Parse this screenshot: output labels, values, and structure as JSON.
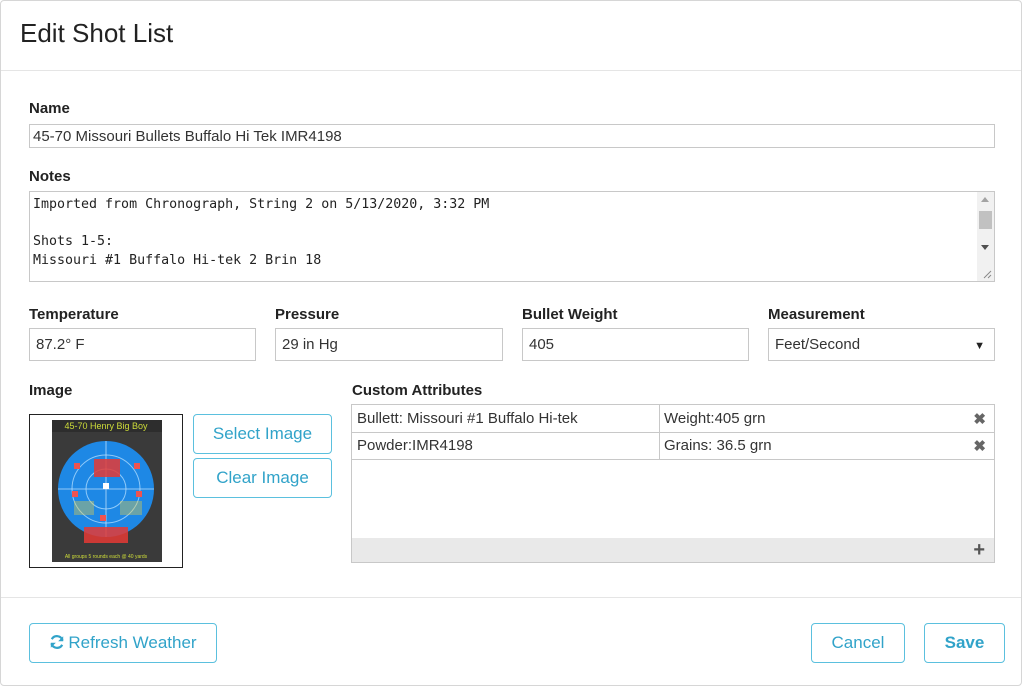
{
  "dialog": {
    "title": "Edit Shot List"
  },
  "name": {
    "label": "Name",
    "value": "45-70 Missouri Bullets Buffalo Hi Tek IMR4198"
  },
  "notes": {
    "label": "Notes",
    "lines": [
      "Imported from Chronograph, String 2 on 5/13/2020, 3:32 PM",
      "",
      "Shots 1-5:",
      "Missouri #1 Buffalo Hi-tek 2 Brin 18"
    ]
  },
  "temperature": {
    "label": "Temperature",
    "value": "87.2° F"
  },
  "pressure": {
    "label": "Pressure",
    "value": "29 in Hg"
  },
  "bullet_weight": {
    "label": "Bullet Weight",
    "value": "405"
  },
  "measurement": {
    "label": "Measurement",
    "value": "Feet/Second"
  },
  "image": {
    "label": "Image",
    "select_label": "Select Image",
    "clear_label": "Clear Image",
    "target_title": "45-70 Henry Big Boy",
    "target_caption": "All groups 5 rounds each @ 40 yards"
  },
  "custom_attributes": {
    "label": "Custom Attributes",
    "rows": [
      {
        "key": "Bullett: Missouri #1 Buffalo Hi-tek",
        "value": "Weight:405 grn"
      },
      {
        "key": "Powder:IMR4198",
        "value": "Grains: 36.5 grn"
      }
    ]
  },
  "footer": {
    "refresh_label": "Refresh Weather",
    "cancel_label": "Cancel",
    "save_label": "Save"
  },
  "colors": {
    "accent": "#31a3c9",
    "border_accent": "#5bc0de",
    "target_blue": "#1e88e5"
  }
}
